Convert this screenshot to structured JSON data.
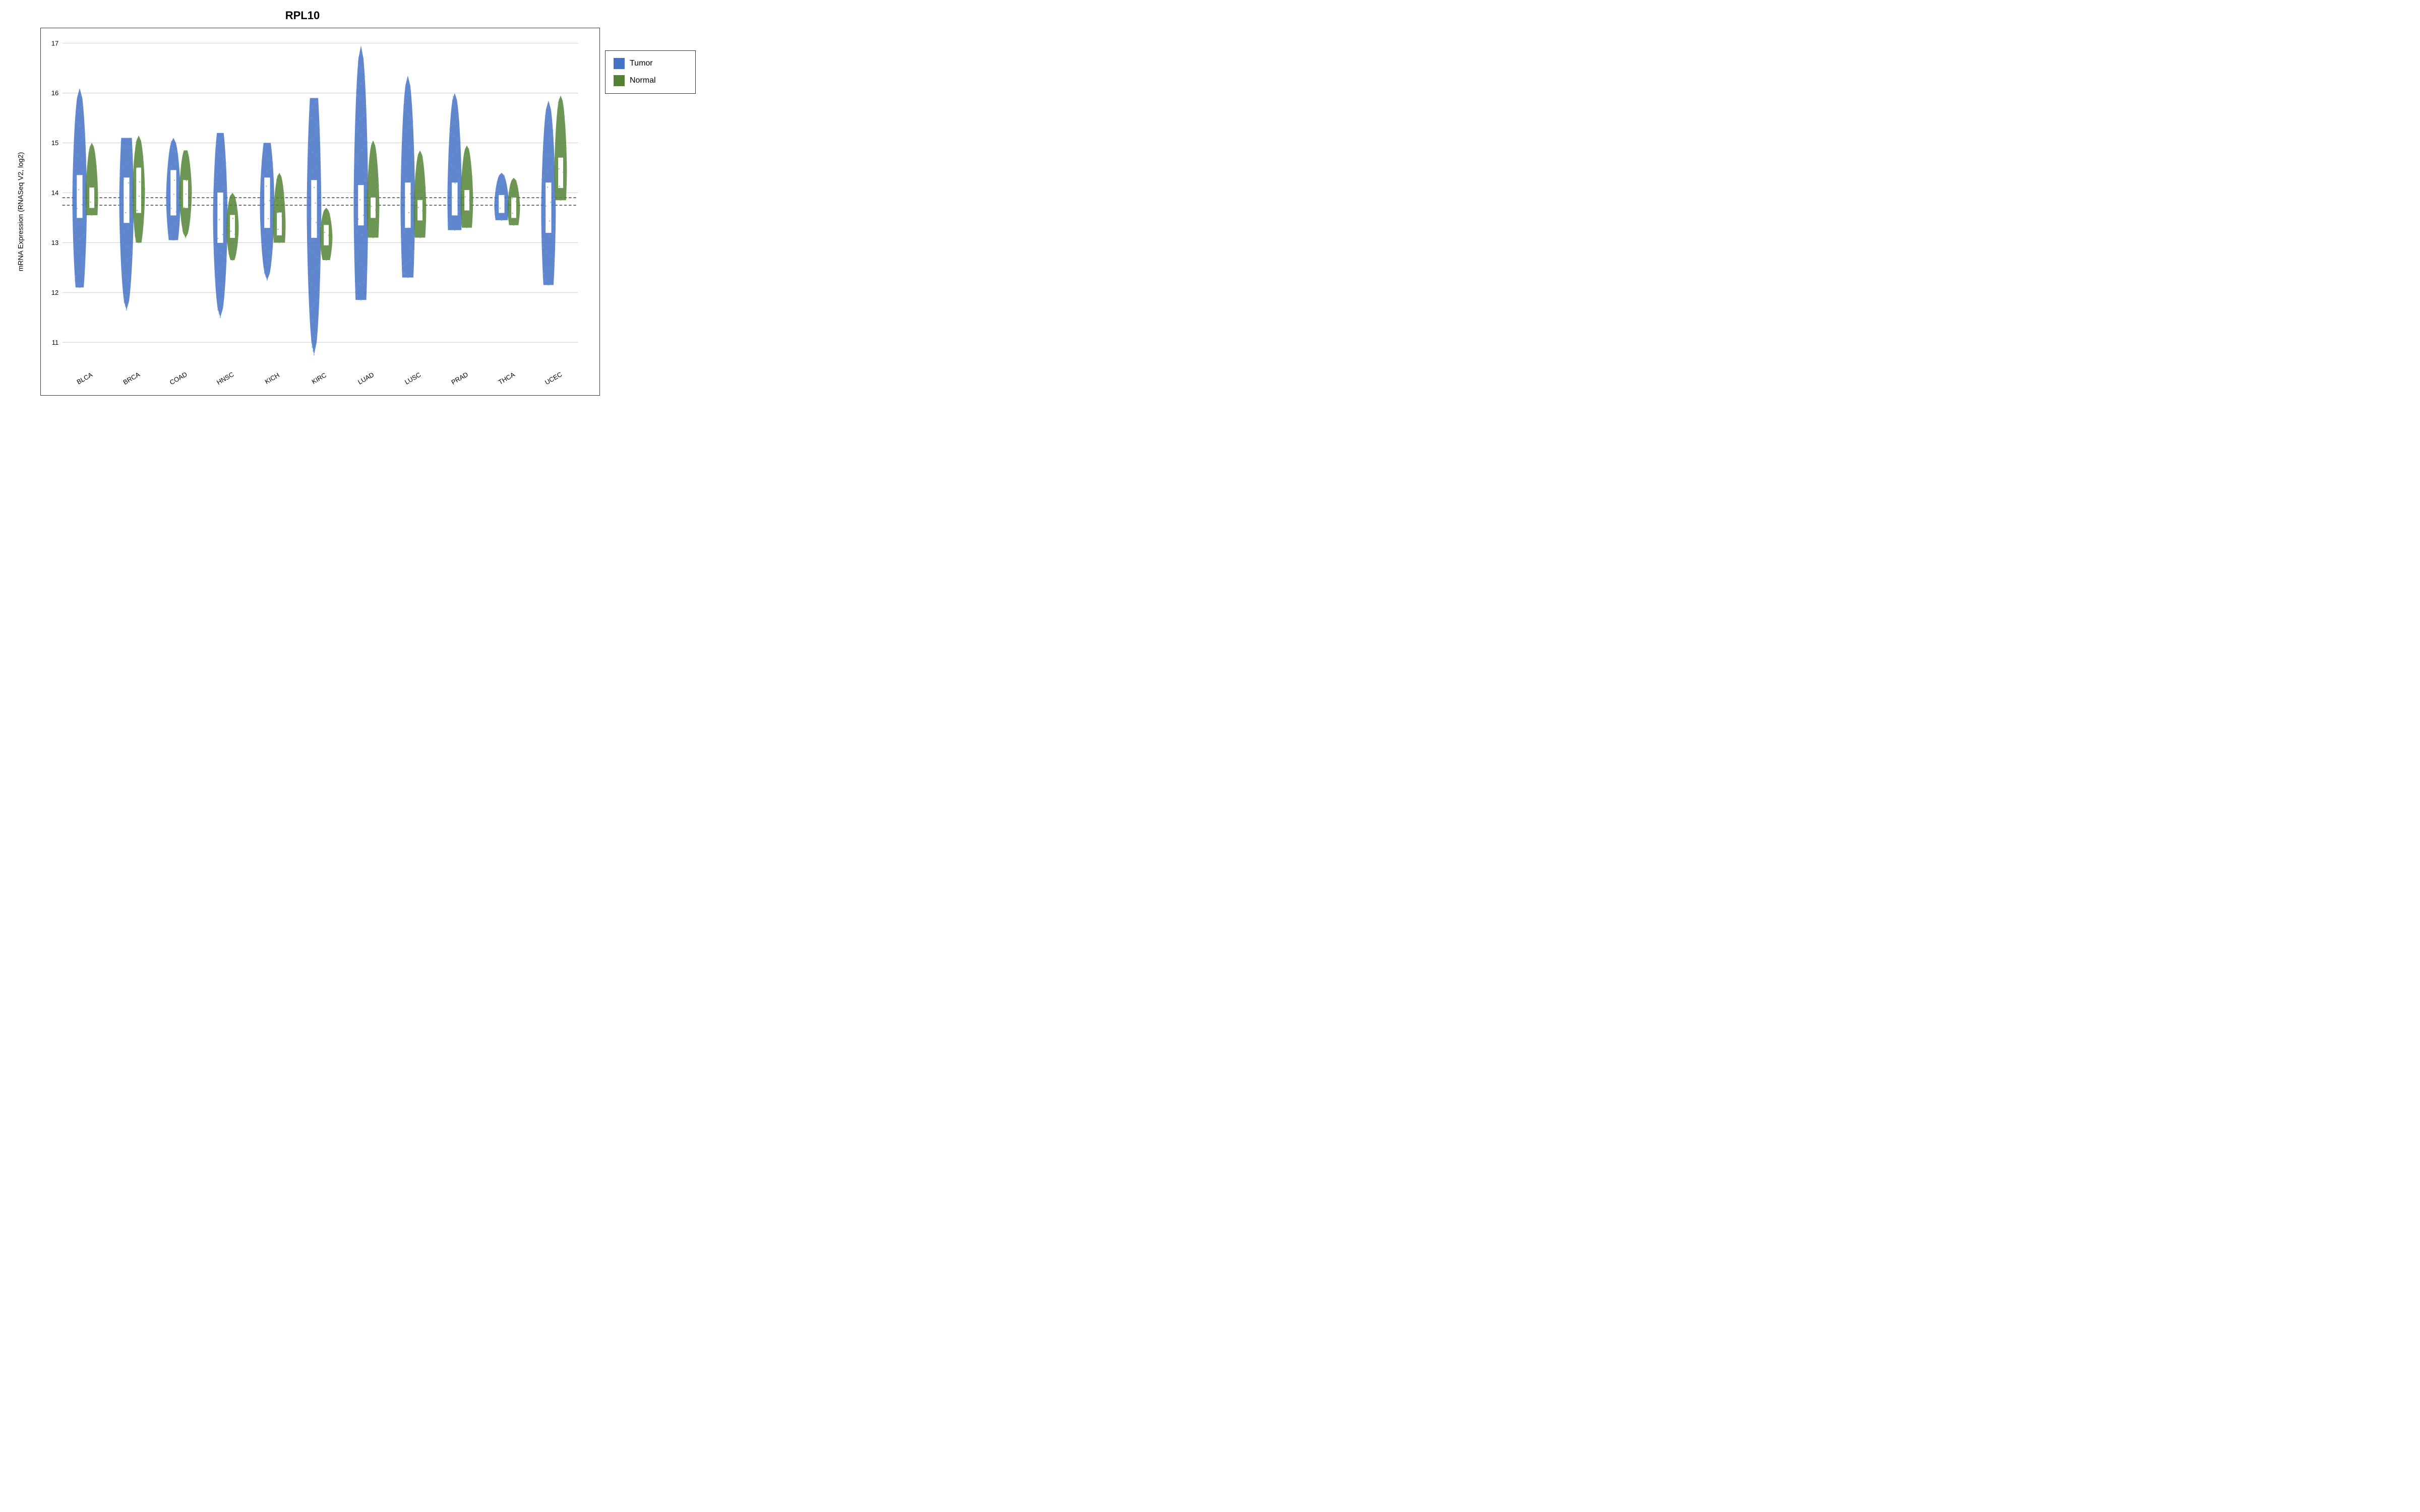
{
  "title": "RPL10",
  "y_axis_label": "mRNA Expression (RNASeq V2, log2)",
  "y_ticks": [
    {
      "value": 11,
      "label": "11"
    },
    {
      "value": 12,
      "label": "12"
    },
    {
      "value": 13,
      "label": "13"
    },
    {
      "value": 14,
      "label": "14"
    },
    {
      "value": 15,
      "label": "15"
    },
    {
      "value": 16,
      "label": "16"
    },
    {
      "value": 17,
      "label": "17"
    }
  ],
  "y_min": 10.5,
  "y_max": 17.3,
  "dotted_lines": [
    13.75,
    13.9
  ],
  "cancer_types": [
    "BLCA",
    "BRCA",
    "COAD",
    "HNSC",
    "KICH",
    "KIRC",
    "LUAD",
    "LUSC",
    "PRAD",
    "THCA",
    "UCEC"
  ],
  "legend": {
    "items": [
      {
        "label": "Tumor",
        "color": "#4472C4"
      },
      {
        "label": "Normal",
        "color": "#548235"
      }
    ]
  },
  "violin_data": {
    "BLCA": {
      "tumor": {
        "center": 13.85,
        "spread": 0.95,
        "top": 16.1,
        "bot": 12.1,
        "iqr_top": 14.35,
        "iqr_bot": 13.5
      },
      "normal": {
        "center": 13.9,
        "spread": 0.55,
        "top": 15.0,
        "bot": 13.55,
        "iqr_top": 14.1,
        "iqr_bot": 13.7
      }
    },
    "BRCA": {
      "tumor": {
        "center": 13.8,
        "spread": 0.9,
        "top": 15.1,
        "bot": 11.65,
        "iqr_top": 14.3,
        "iqr_bot": 13.4
      },
      "normal": {
        "center": 14.0,
        "spread": 0.65,
        "top": 15.15,
        "bot": 13.0,
        "iqr_top": 14.5,
        "iqr_bot": 13.6
      }
    },
    "COAD": {
      "tumor": {
        "center": 13.9,
        "spread": 1.0,
        "top": 15.1,
        "bot": 13.05,
        "iqr_top": 14.45,
        "iqr_bot": 13.55
      },
      "normal": {
        "center": 14.0,
        "spread": 0.65,
        "top": 14.85,
        "bot": 13.1,
        "iqr_top": 14.25,
        "iqr_bot": 13.7
      }
    },
    "HNSC": {
      "tumor": {
        "center": 13.5,
        "spread": 1.1,
        "top": 15.2,
        "bot": 11.5,
        "iqr_top": 14.0,
        "iqr_bot": 13.0
      },
      "normal": {
        "center": 13.3,
        "spread": 0.5,
        "top": 14.0,
        "bot": 12.65,
        "iqr_top": 13.55,
        "iqr_bot": 13.1
      }
    },
    "KICH": {
      "tumor": {
        "center": 13.75,
        "spread": 1.05,
        "top": 15.0,
        "bot": 12.25,
        "iqr_top": 14.3,
        "iqr_bot": 13.3
      },
      "normal": {
        "center": 13.35,
        "spread": 0.5,
        "top": 14.4,
        "bot": 13.0,
        "iqr_top": 13.6,
        "iqr_bot": 13.15
      }
    },
    "KIRC": {
      "tumor": {
        "center": 13.65,
        "spread": 1.05,
        "top": 15.9,
        "bot": 10.75,
        "iqr_top": 14.25,
        "iqr_bot": 13.1
      },
      "normal": {
        "center": 13.1,
        "spread": 0.55,
        "top": 13.7,
        "bot": 12.65,
        "iqr_top": 13.35,
        "iqr_bot": 12.95
      }
    },
    "LUAD": {
      "tumor": {
        "center": 13.75,
        "spread": 0.85,
        "top": 16.95,
        "bot": 11.85,
        "iqr_top": 14.15,
        "iqr_bot": 13.35
      },
      "normal": {
        "center": 13.7,
        "spread": 0.45,
        "top": 15.05,
        "bot": 13.1,
        "iqr_top": 13.9,
        "iqr_bot": 13.5
      }
    },
    "LUSC": {
      "tumor": {
        "center": 13.75,
        "spread": 0.85,
        "top": 16.35,
        "bot": 12.3,
        "iqr_top": 14.2,
        "iqr_bot": 13.3
      },
      "normal": {
        "center": 13.65,
        "spread": 0.45,
        "top": 14.85,
        "bot": 13.1,
        "iqr_top": 13.85,
        "iqr_bot": 13.45
      }
    },
    "PRAD": {
      "tumor": {
        "center": 13.85,
        "spread": 0.8,
        "top": 16.0,
        "bot": 13.25,
        "iqr_top": 14.2,
        "iqr_bot": 13.55
      },
      "normal": {
        "center": 13.85,
        "spread": 0.5,
        "top": 14.95,
        "bot": 13.3,
        "iqr_top": 14.05,
        "iqr_bot": 13.65
      }
    },
    "THCA": {
      "tumor": {
        "center": 13.75,
        "spread": 0.55,
        "top": 14.4,
        "bot": 13.45,
        "iqr_top": 13.95,
        "iqr_bot": 13.6
      },
      "normal": {
        "center": 13.7,
        "spread": 0.5,
        "top": 14.3,
        "bot": 13.35,
        "iqr_top": 13.9,
        "iqr_bot": 13.5
      }
    },
    "UCEC": {
      "tumor": {
        "center": 13.6,
        "spread": 1.0,
        "top": 15.85,
        "bot": 12.15,
        "iqr_top": 14.2,
        "iqr_bot": 13.2
      },
      "normal": {
        "center": 14.45,
        "spread": 0.55,
        "top": 15.95,
        "bot": 13.85,
        "iqr_top": 14.7,
        "iqr_bot": 14.1
      }
    }
  }
}
